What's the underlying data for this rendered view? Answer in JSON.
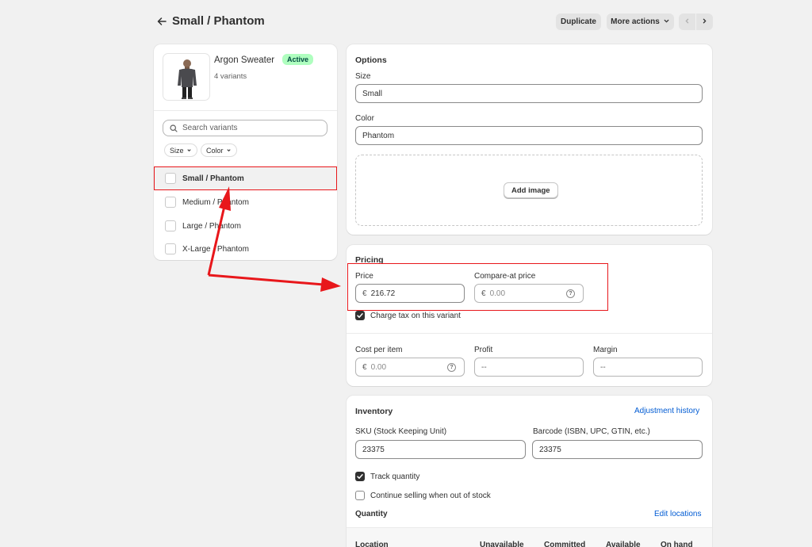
{
  "header": {
    "title": "Small / Phantom",
    "duplicate_label": "Duplicate",
    "more_actions_label": "More actions"
  },
  "product": {
    "name": "Argon Sweater",
    "status": "Active",
    "variant_count": "4 variants"
  },
  "variants_panel": {
    "search_placeholder": "Search variants",
    "filters": [
      "Size",
      "Color"
    ],
    "items": [
      {
        "label": "Small / Phantom",
        "selected": true
      },
      {
        "label": "Medium / Phantom",
        "selected": false
      },
      {
        "label": "Large / Phantom",
        "selected": false
      },
      {
        "label": "X-Large / Phantom",
        "selected": false
      }
    ]
  },
  "options": {
    "title": "Options",
    "size_label": "Size",
    "size_value": "Small",
    "color_label": "Color",
    "color_value": "Phantom",
    "add_image_label": "Add image"
  },
  "pricing": {
    "title": "Pricing",
    "price_label": "Price",
    "currency": "€",
    "price_value": "216.72",
    "compare_label": "Compare-at price",
    "compare_placeholder": "0.00",
    "charge_tax_label": "Charge tax on this variant",
    "charge_tax_checked": true,
    "cost_label": "Cost per item",
    "cost_placeholder": "0.00",
    "profit_label": "Profit",
    "profit_value": "--",
    "margin_label": "Margin",
    "margin_value": "--"
  },
  "inventory": {
    "title": "Inventory",
    "adjustment_history_label": "Adjustment history",
    "sku_label": "SKU (Stock Keeping Unit)",
    "sku_value": "23375",
    "barcode_label": "Barcode (ISBN, UPC, GTIN, etc.)",
    "barcode_value": "23375",
    "track_quantity_label": "Track quantity",
    "track_quantity_checked": true,
    "continue_selling_label": "Continue selling when out of stock",
    "continue_selling_checked": false,
    "quantity_title": "Quantity",
    "edit_locations_label": "Edit locations",
    "columns": [
      "Location",
      "Unavailable",
      "Committed",
      "Available",
      "On hand"
    ]
  },
  "colors": {
    "annotation_red": "#e8171b",
    "active_badge_bg": "#affebf",
    "link_blue": "#005bd3"
  }
}
